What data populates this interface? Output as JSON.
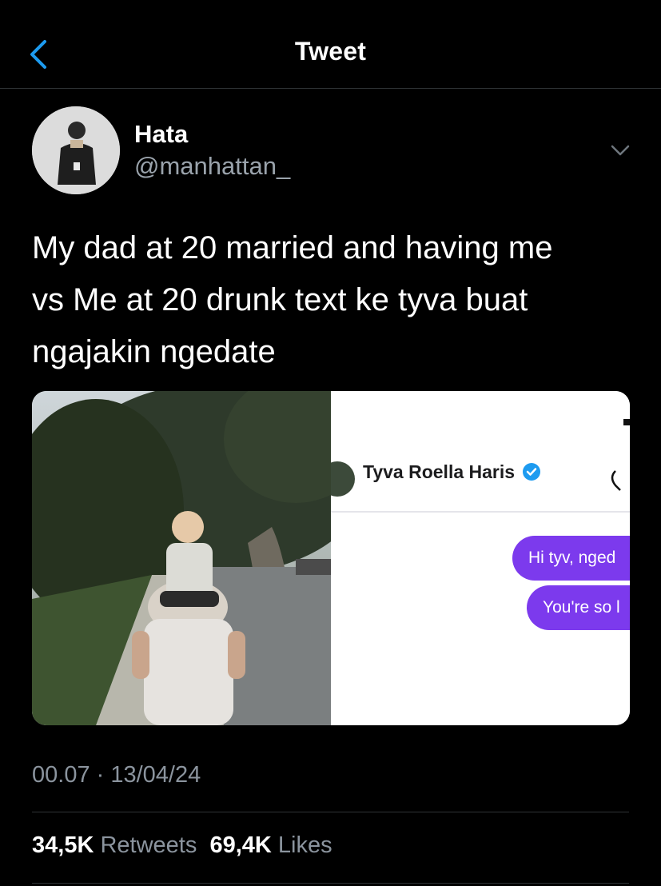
{
  "nav": {
    "title": "Tweet",
    "back_icon": "chevron-left-icon"
  },
  "colors": {
    "accent": "#1d9bf0",
    "background": "#000000",
    "muted": "#8b949e",
    "bubble": "#7c3aed"
  },
  "tweet": {
    "author": {
      "name": "Hata",
      "handle": "@manhattan_"
    },
    "lines": [
      "My dad at 20 married and having me",
      "vs Me at 20 drunk text ke tyva buat",
      "ngajakin ngedate"
    ],
    "timestamp": "00.07 · 13/04/24",
    "stats": {
      "retweets_count": "34,5K",
      "retweets_label": "Retweets",
      "likes_count": "69,4K",
      "likes_label": "Likes"
    }
  },
  "media": {
    "chat": {
      "contact_name": "Tyva Roella Haris",
      "messages": [
        "Hi tyv, nged",
        "You're so l"
      ]
    }
  }
}
